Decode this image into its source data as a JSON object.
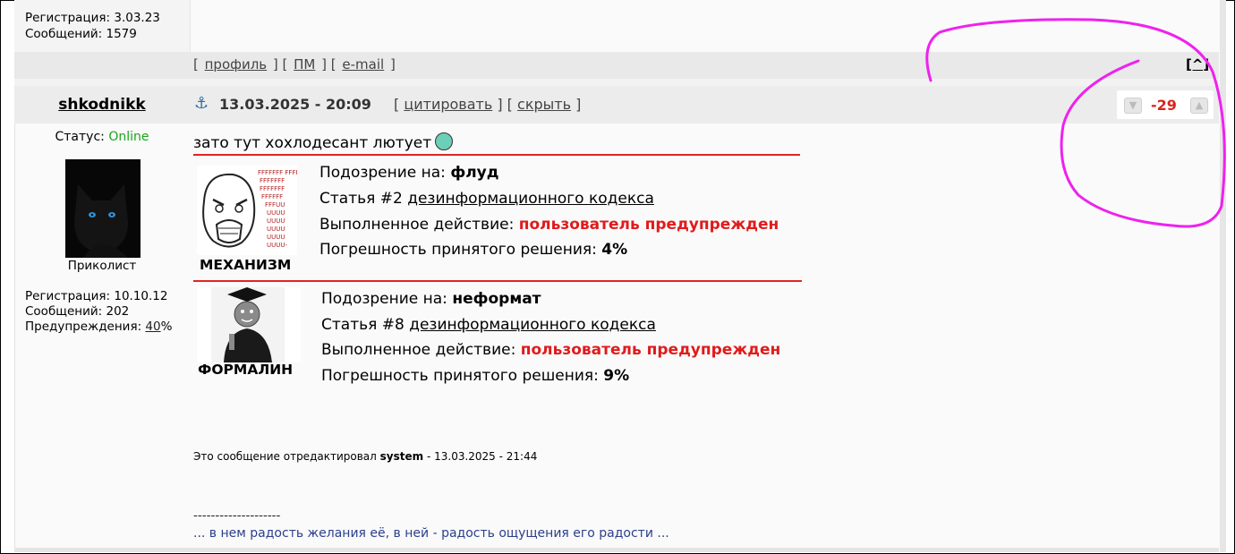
{
  "prev_post": {
    "registration": "Регистрация: 3.03.23",
    "messages": "Сообщений: 1579",
    "links": [
      "профиль",
      "ПМ",
      "e-mail"
    ],
    "to_top": "[^]"
  },
  "post": {
    "username": "shkodnikk",
    "anchor_icon": "anchor-icon",
    "date": "13.03.2025 - 20:09",
    "actions": [
      "цитировать",
      "скрыть"
    ],
    "rating": "-29",
    "status_label": "Статус:",
    "status_value": "Online",
    "rank": "Приколист",
    "registration": "Регистрация: 10.10.12",
    "messages": "Сообщений: 202",
    "warnings_label": "Предупреждения:",
    "warnings_value": "40",
    "warnings_unit": "%",
    "text": "зато тут хохлодесант лютует",
    "mod_blocks": [
      {
        "stamp_caption": "МЕХАНИЗМ",
        "stamp_text": "FFFFFFF FFFFFFF FFFFFFF FFFFFF FFFUU UUUU UUUU UUUU UUUU UUUU-",
        "suspicion_label": "Подозрение на:",
        "suspicion_value": "флуд",
        "article_label": "Статья #2",
        "article_link": "дезинформационного кодекса",
        "action_label": "Выполненное действие:",
        "action_value": "пользователь предупрежден",
        "error_label": "Погрешность принятого решения:",
        "error_value": "4%"
      },
      {
        "stamp_caption": "ФОРМАЛИН",
        "suspicion_label": "Подозрение на:",
        "suspicion_value": "неформат",
        "article_label": "Статья #8",
        "article_link": "дезинформационного кодекса",
        "action_label": "Выполненное действие:",
        "action_value": "пользователь предупрежден",
        "error_label": "Погрешность принятого решения:",
        "error_value": "9%"
      }
    ],
    "edited_prefix": "Это сообщение отредактировал",
    "edited_by": "system",
    "edited_suffix": "- 13.03.2025 - 21:44",
    "sig_separator": "--------------------",
    "signature": "... в нем радость желания её, в ней - радость ощущения его радости ..."
  },
  "colors": {
    "online": "#1aa51a",
    "rating_negative": "#d8241c",
    "mod_red": "#e01b1b",
    "annotation_magenta": "#ee22ee"
  }
}
